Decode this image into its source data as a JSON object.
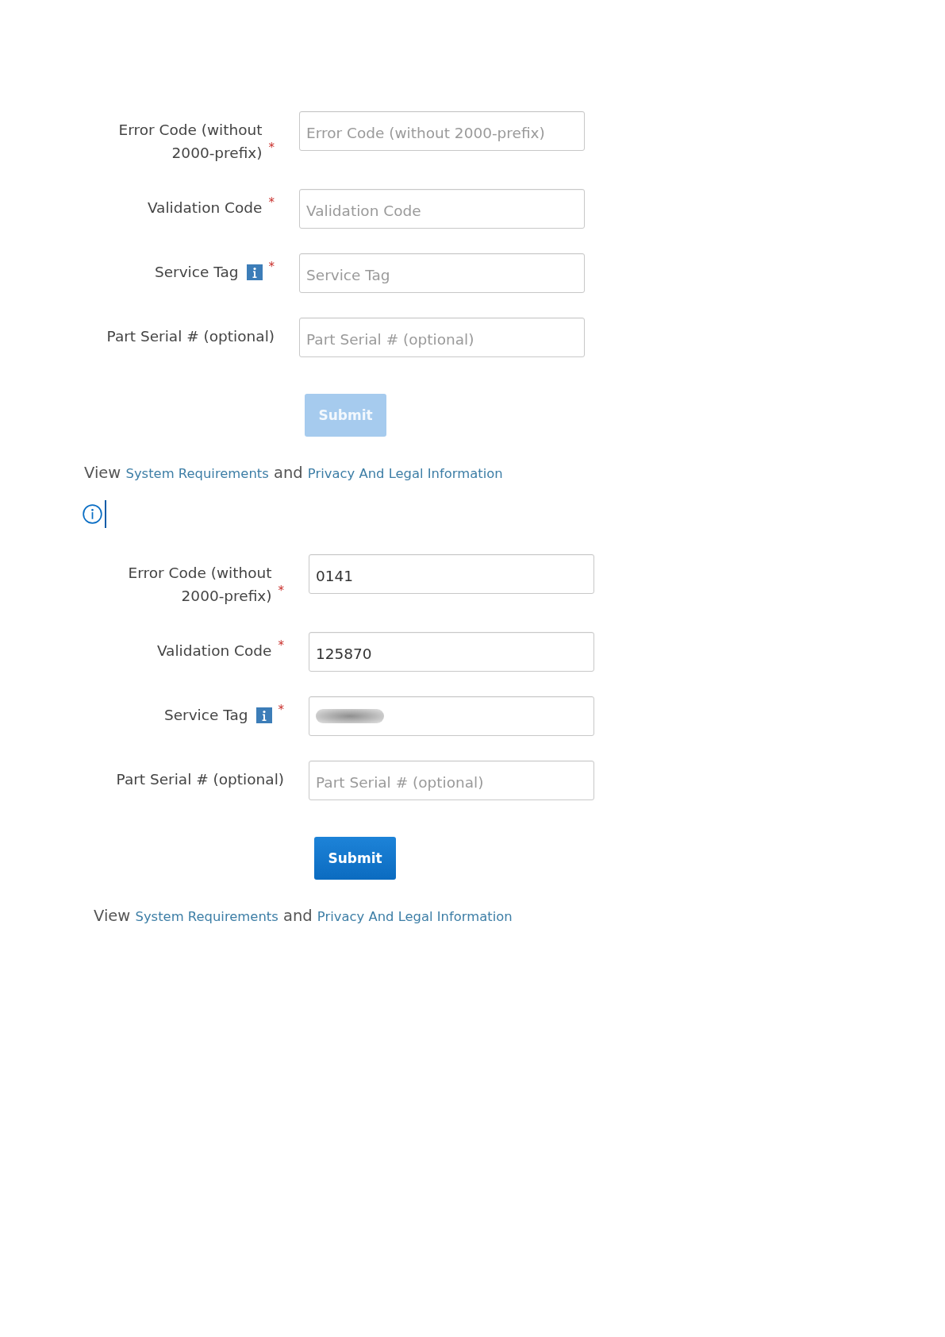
{
  "blocks": [
    {
      "kind": "form",
      "fields": [
        {
          "label": "Error Code (without 2000-prefix)",
          "info": false,
          "required_mark": "*",
          "placeholder": "Error Code (without 2000-prefix)",
          "blurred": false
        },
        {
          "label": "Validation Code",
          "info": false,
          "required_mark": "*",
          "placeholder": "Validation Code",
          "blurred": false
        },
        {
          "label": "Service Tag",
          "info": true,
          "required_mark": "*",
          "placeholder": "Service Tag",
          "blurred": false
        },
        {
          "label": "Part Serial # (optional)",
          "info": false,
          "placeholder": "Part Serial # (optional)",
          "blurred": false
        }
      ],
      "submit": {
        "label": "Submit",
        "disabled": true
      },
      "footer": [
        {
          "kind": "text",
          "text": "View"
        },
        {
          "kind": "link",
          "text": "System Requirements"
        },
        {
          "kind": "text",
          "text": "and"
        },
        {
          "kind": "link",
          "text": "Privacy And Legal Information"
        }
      ]
    },
    {
      "kind": "note",
      "cursor": true
    },
    {
      "kind": "form",
      "fields": [
        {
          "label": "Error Code (without 2000-prefix)",
          "info": false,
          "required_mark": "*",
          "value": "0141",
          "blurred": false
        },
        {
          "label": "Validation Code",
          "info": false,
          "required_mark": "*",
          "value": "125870",
          "blurred": false
        },
        {
          "label": "Service Tag",
          "info": true,
          "required_mark": "*",
          "blurred": true
        },
        {
          "label": "Part Serial # (optional)",
          "info": false,
          "placeholder": "Part Serial # (optional)",
          "blurred": false
        }
      ],
      "submit": {
        "label": "Submit",
        "disabled": false
      },
      "footer": [
        {
          "kind": "text",
          "text": "View"
        },
        {
          "kind": "link",
          "text": "System Requirements"
        },
        {
          "kind": "text",
          "text": "and"
        },
        {
          "kind": "link",
          "text": "Privacy And Legal Information"
        }
      ]
    }
  ]
}
